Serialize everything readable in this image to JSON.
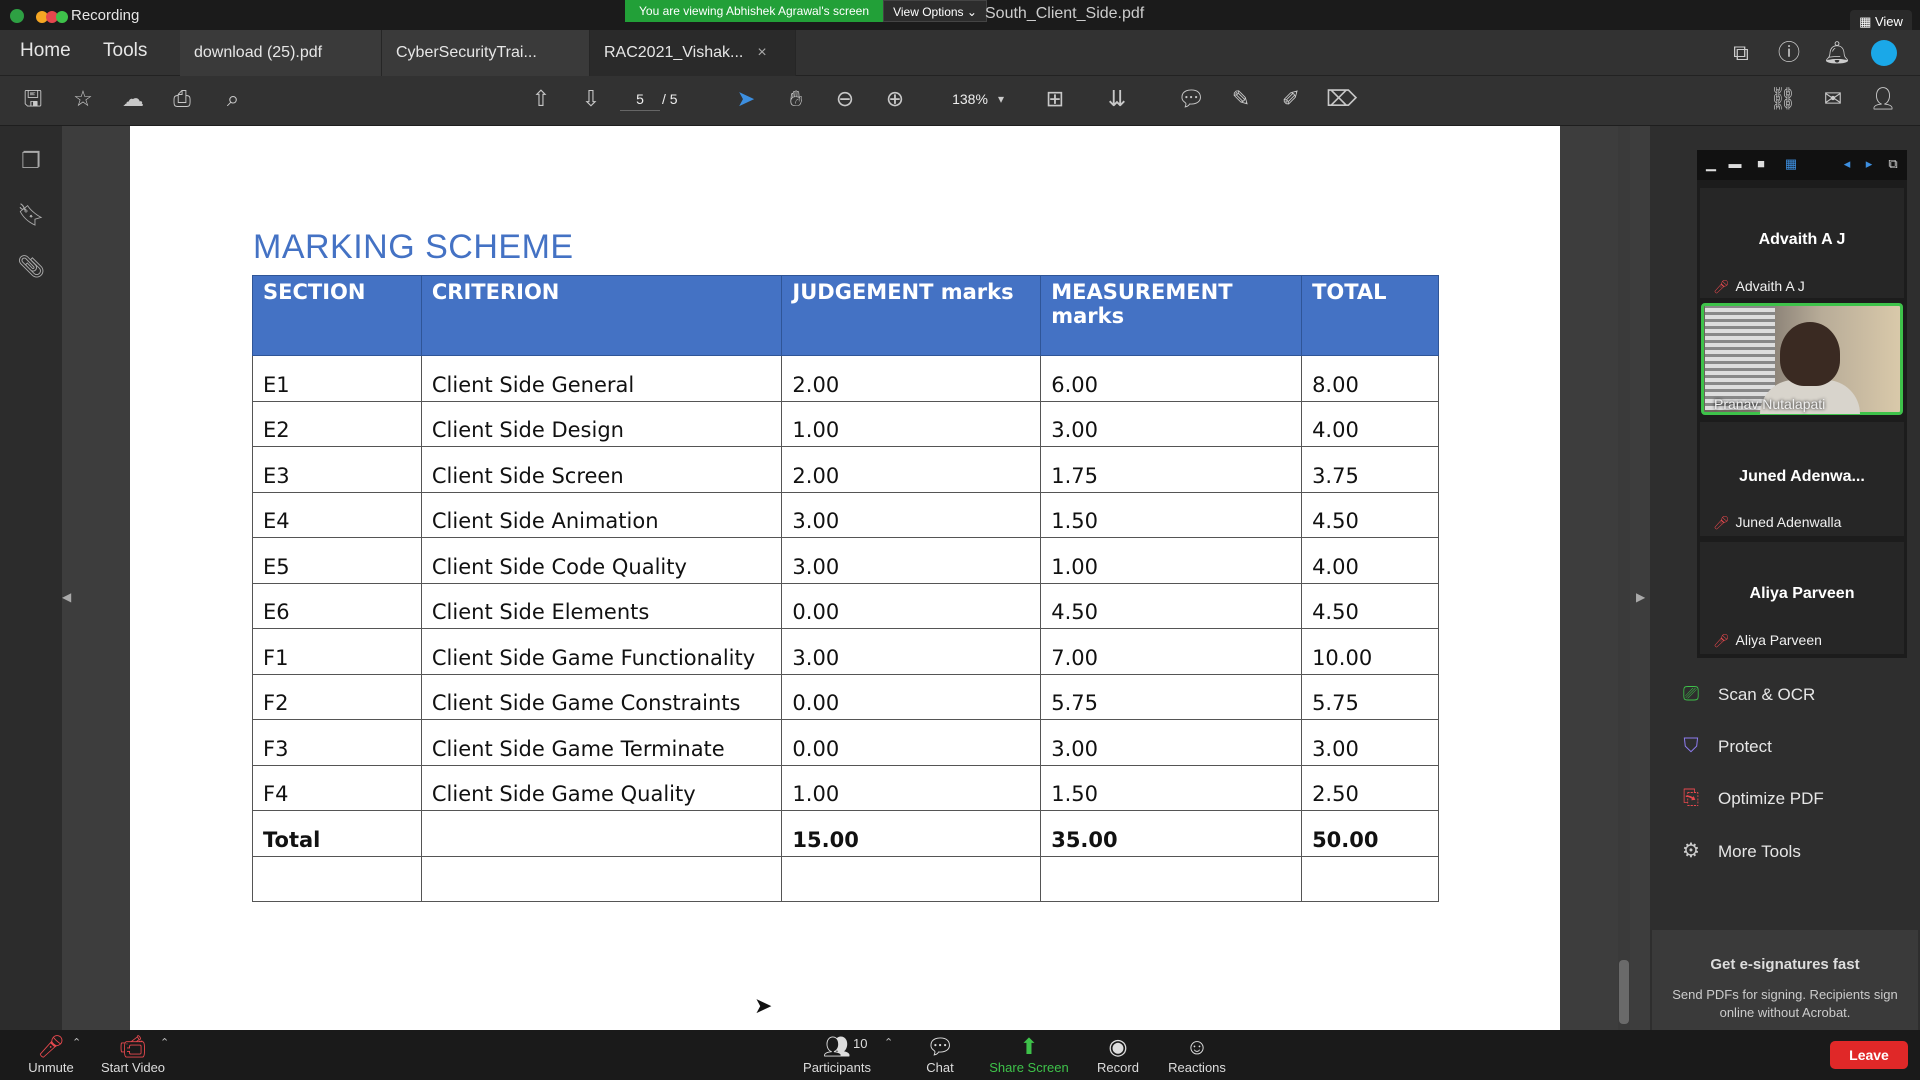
{
  "zoom": {
    "recording_label": "Recording",
    "viewing_banner": "You are viewing Abhishek Agrawal's screen",
    "view_options": "View Options ⌄",
    "window_title": "South_Client_Side.pdf",
    "view_button": "View",
    "participants_count": "10",
    "bottom": {
      "unmute": "Unmute",
      "start_video": "Start Video",
      "participants": "Participants",
      "chat": "Chat",
      "share_screen": "Share Screen",
      "record": "Record",
      "reactions": "Reactions",
      "leave": "Leave"
    },
    "gallery": [
      {
        "display": "Advaith A J",
        "label": "Advaith A J"
      },
      {
        "display": "",
        "label": "Pranav Nutalapati"
      },
      {
        "display": "Juned Adenwa...",
        "label": "Juned Adenwalla"
      },
      {
        "display": "Aliya Parveen",
        "label": "Aliya Parveen"
      }
    ]
  },
  "acrobat": {
    "menu": {
      "home": "Home",
      "tools": "Tools"
    },
    "tabs": [
      {
        "label": "download (25).pdf"
      },
      {
        "label": "CyberSecurityTrai..."
      },
      {
        "label": "RAC2021_Vishak...",
        "close": "×"
      }
    ],
    "page_current": "5",
    "page_total": "/ 5",
    "zoom_level": "138%",
    "right_tools": [
      {
        "label": "Scan & OCR"
      },
      {
        "label": "Protect"
      },
      {
        "label": "Optimize PDF"
      },
      {
        "label": "More Tools"
      }
    ],
    "esign": {
      "title": "Get e-signatures fast",
      "body": "Send PDFs for signing. Recipients sign online without Acrobat."
    }
  },
  "document": {
    "heading": "MARKING SCHEME",
    "columns": [
      "SECTION",
      "CRITERION",
      "JUDGEMENT marks",
      "MEASUREMENT marks",
      "TOTAL"
    ],
    "rows": [
      [
        "E1",
        "Client Side General",
        "2.00",
        "6.00",
        "8.00"
      ],
      [
        "E2",
        "Client Side Design",
        "1.00",
        "3.00",
        "4.00"
      ],
      [
        "E3",
        "Client Side Screen",
        "2.00",
        "1.75",
        "3.75"
      ],
      [
        "E4",
        "Client Side Animation",
        "3.00",
        "1.50",
        "4.50"
      ],
      [
        "E5",
        "Client Side Code Quality",
        "3.00",
        "1.00",
        "4.00"
      ],
      [
        "E6",
        "Client Side Elements",
        "0.00",
        "4.50",
        "4.50"
      ],
      [
        "F1",
        "Client Side Game Functionality",
        "3.00",
        "7.00",
        "10.00"
      ],
      [
        "F2",
        "Client Side Game Constraints",
        "0.00",
        "5.75",
        "5.75"
      ],
      [
        "F3",
        "Client Side Game Terminate",
        "0.00",
        "3.00",
        "3.00"
      ],
      [
        "F4",
        "Client Side Game Quality",
        "1.00",
        "1.50",
        "2.50"
      ]
    ],
    "total_row": [
      "Total",
      "",
      "15.00",
      "35.00",
      "50.00"
    ]
  },
  "colors": {
    "header_blue": "#4472c4",
    "zoom_green": "#22a038",
    "leave_red": "#e02828"
  }
}
